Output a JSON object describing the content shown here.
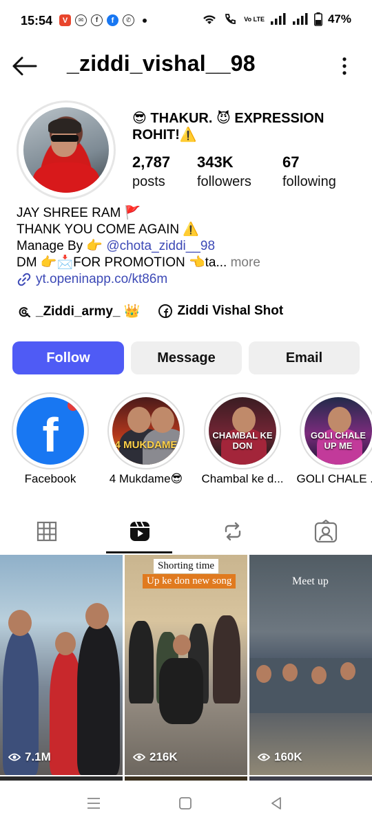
{
  "status_bar": {
    "time": "15:54",
    "battery": "47%",
    "network": "Vo LTE"
  },
  "header": {
    "username": "_ziddi_vishal__98"
  },
  "profile": {
    "display_name": "😎 THAKUR. 😈 EXPRESSION ROHIT!⚠️",
    "stats": [
      {
        "value": "2,787",
        "label": "posts"
      },
      {
        "value": "343K",
        "label": "followers"
      },
      {
        "value": "67",
        "label": "following"
      }
    ],
    "bio": {
      "line1": "JAY SHREE RAM 🚩",
      "line2": "THANK YOU COME AGAIN ⚠️",
      "line3_prefix": "Manage By 👉 ",
      "line3_mention": "@chota_ziddi__98",
      "line4": "DM 👉📩FOR PROMOTION 👈ta",
      "line4_ellipsis": "... ",
      "more": "more",
      "link": "yt.openinapp.co/kt86m"
    },
    "tags": [
      {
        "label": "_Ziddi_army_ 👑",
        "icon": "threads-icon"
      },
      {
        "label": "Ziddi Vishal Shot",
        "icon": "facebook-icon"
      }
    ]
  },
  "actions": {
    "follow": "Follow",
    "message": "Message",
    "email": "Email"
  },
  "highlights": [
    {
      "label": "Facebook",
      "art": "f"
    },
    {
      "label": "4 Mukdame😎",
      "art": "4 MUKDAME"
    },
    {
      "label": "Chambal ke d...",
      "art": "CHAMBAL KE DON"
    },
    {
      "label": "GOLI CHALE ...",
      "art": "GOLI CHALE UP ME"
    }
  ],
  "tabs": [
    {
      "name": "grid-icon",
      "active": false
    },
    {
      "name": "reels-icon",
      "active": true
    },
    {
      "name": "reposts-icon",
      "active": false
    },
    {
      "name": "tagged-icon",
      "active": false
    }
  ],
  "reels": [
    {
      "views": "7.1M",
      "captions": []
    },
    {
      "views": "216K",
      "captions": [
        "Shorting time",
        "Up ke don new song"
      ]
    },
    {
      "views": "160K",
      "captions": [
        "Meet up"
      ]
    }
  ],
  "colors": {
    "follow_button": "#4f5bf5",
    "secondary_button": "#efefef",
    "link": "#3c49b6"
  }
}
